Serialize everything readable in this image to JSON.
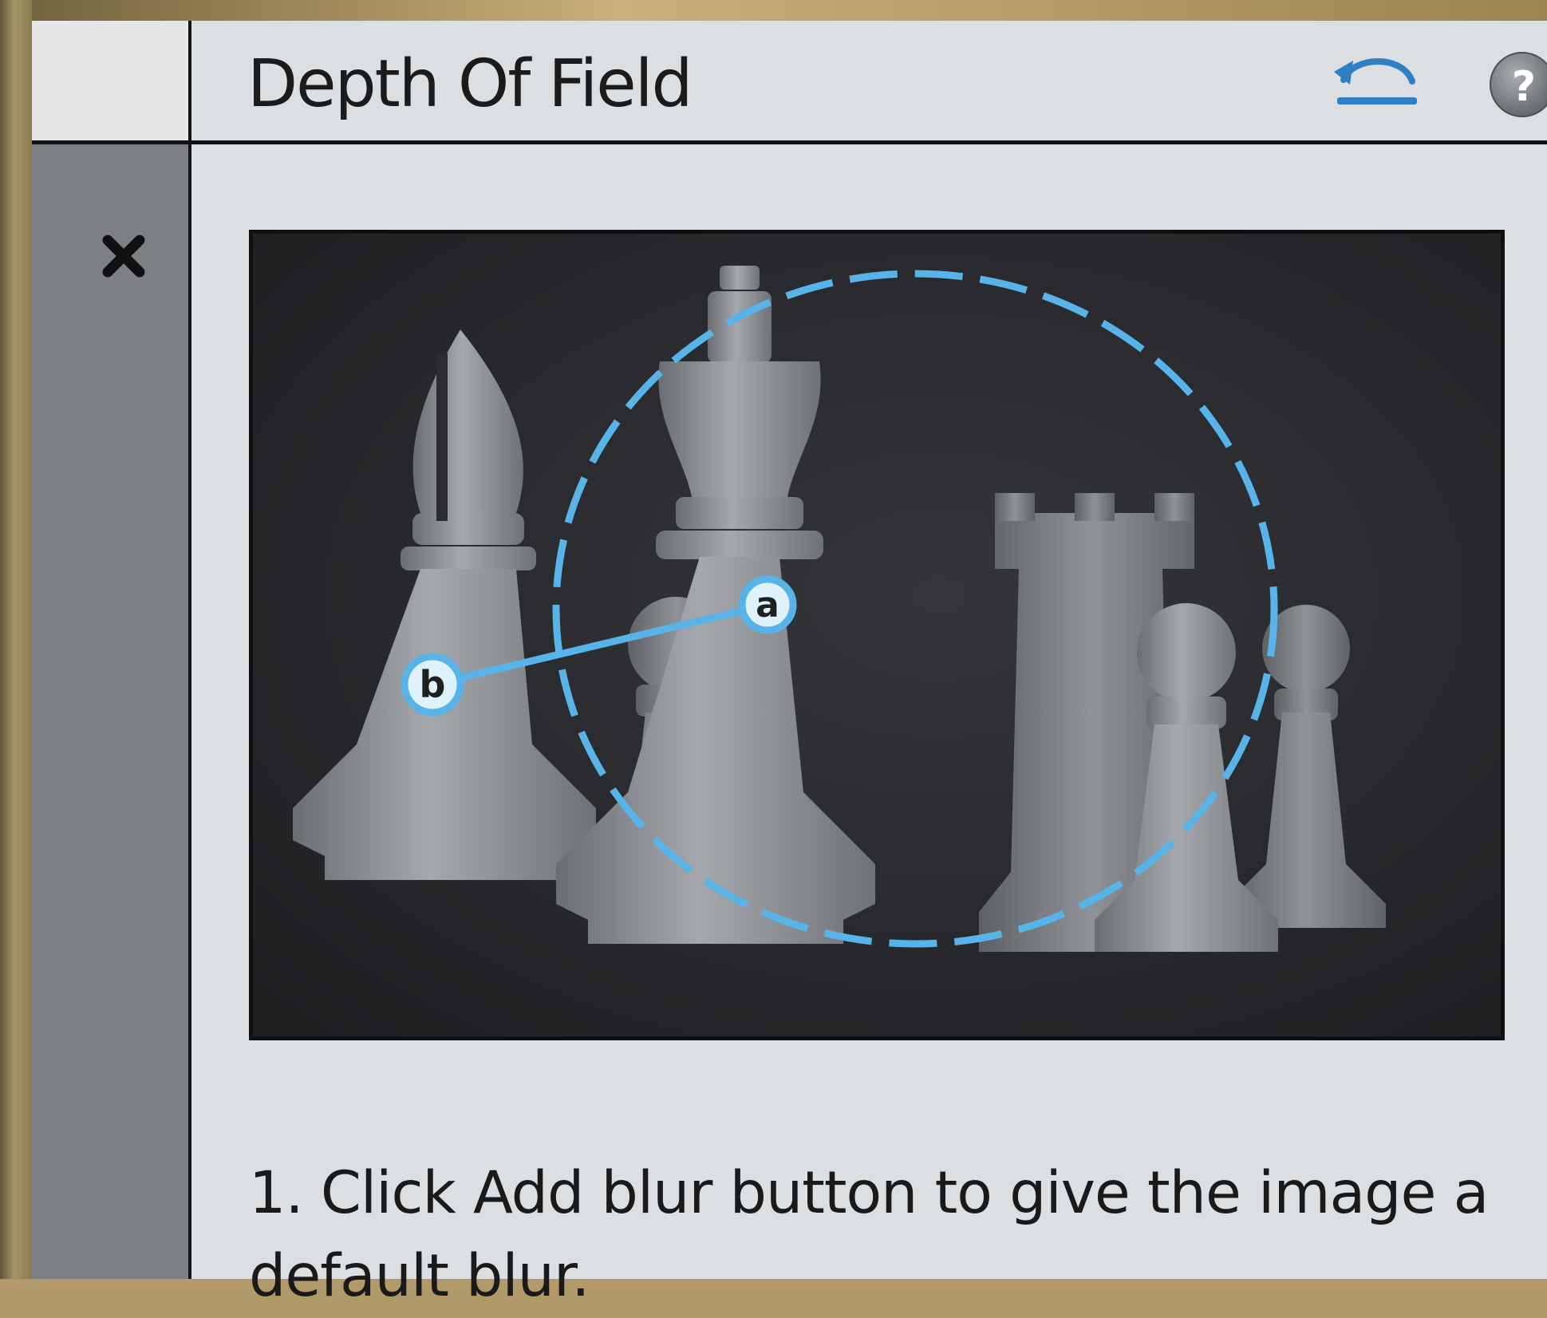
{
  "panel": {
    "title": "Depth Of Field",
    "reset_icon": "reset-arrow-icon",
    "help_icon": "help-icon",
    "close_icon": "close-icon"
  },
  "preview": {
    "markers": {
      "a": "a",
      "b": "b"
    },
    "pieces": [
      "bishop-piece",
      "pawn-piece",
      "king-piece",
      "rook-piece",
      "pawn-piece",
      "pawn-piece"
    ],
    "focus_ring_color": "#58b4e8"
  },
  "instructions": {
    "step_1": "1. Click Add blur button to give the image a default blur."
  },
  "colors": {
    "panel_bg": "#dcdfe2",
    "gutter_bg": "#7d8186",
    "accent": "#2f7fc4"
  }
}
